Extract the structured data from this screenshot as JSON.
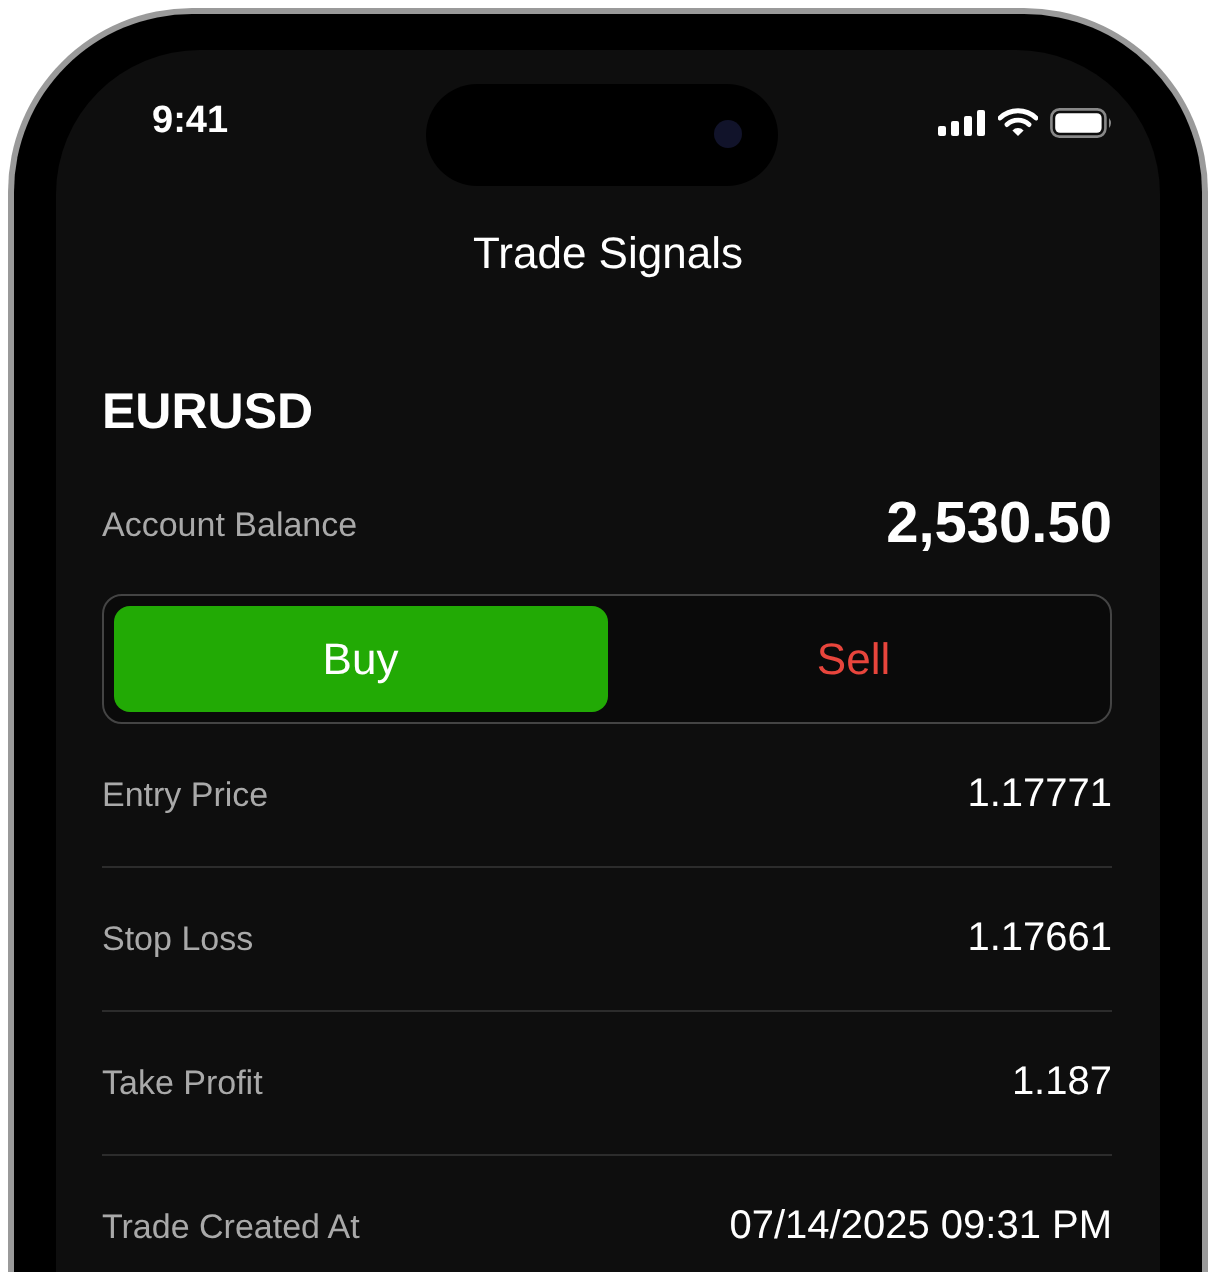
{
  "status_bar": {
    "time": "9:41"
  },
  "header": {
    "title": "Trade Signals"
  },
  "symbol": "EURUSD",
  "balance": {
    "label": "Account Balance",
    "value": "2,530.50"
  },
  "sides": [
    {
      "label": "Buy",
      "kind": "buy",
      "selected": true
    },
    {
      "label": "Sell",
      "kind": "sell",
      "selected": false
    }
  ],
  "details": [
    {
      "label": "Entry Price",
      "value": "1.17771"
    },
    {
      "label": "Stop Loss",
      "value": "1.17661"
    },
    {
      "label": "Take Profit",
      "value": "1.187"
    },
    {
      "label": "Trade Created At",
      "value": "07/14/2025 09:31 PM"
    }
  ]
}
